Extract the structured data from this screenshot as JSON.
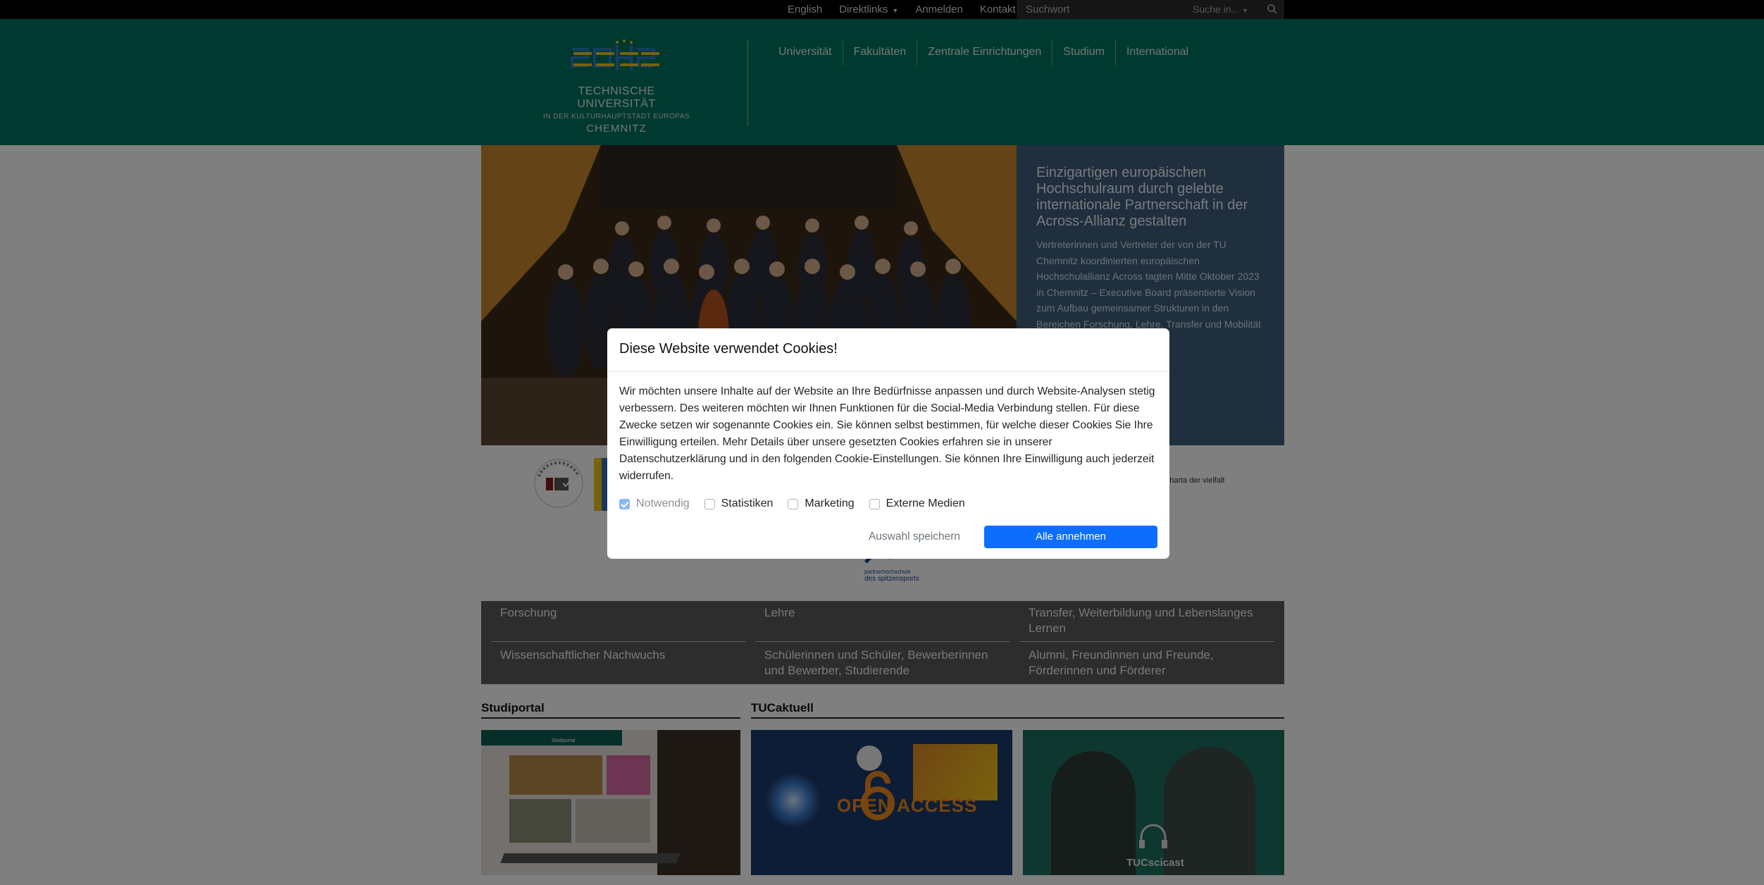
{
  "topbar": {
    "links": [
      "English",
      "Direktlinks",
      "Anmelden",
      "Kontakt"
    ],
    "search_placeholder": "Suchwort",
    "search_in": "Suche in..."
  },
  "header": {
    "logo_line1": "TECHNISCHE UNIVERSITÄT",
    "logo_line2": "IN DER KULTURHAUPTSTADT EUROPAS",
    "logo_line3": "CHEMNITZ",
    "nav": [
      "Universität",
      "Fakultäten",
      "Zentrale Einrichtungen",
      "Studium",
      "International"
    ]
  },
  "hero": {
    "headline": "Einzigartigen europäischen Hochschulraum durch gelebte internationale Partnerschaft in der Across-Allianz gestalten",
    "text": "Vertreterinnen und Vertreter der von der TU Chemnitz koordinierten europäischen Hochschulallianz Across tagten Mitte Oktober 2023 in Chemnitz – Executive Board präsentierte Vision zum Aufbau gemeinsamer Strukturen in den Bereichen Forschung, Lehre, Transfer und Mobilität"
  },
  "partners": {
    "charta": "charta der vielfalt",
    "spitzensport_1": "partnerhochschule",
    "spitzensport_2": "des spitzensports"
  },
  "linkgrid": [
    "Forschung",
    "Lehre",
    "Transfer, Weiterbildung und Lebenslanges Lernen",
    "Wissenschaftlicher Nachwuchs",
    "Schülerinnen und Schüler, Bewerberinnen und Bewerber, Studierende",
    "Alumni, Freundinnen und Freunde, Förderinnen und Förderer"
  ],
  "sections": {
    "studiportal": "Studiportal",
    "tucaktuell": "TUCaktuell",
    "open_access": "OPEN ACCESS",
    "tucscicast": "TUCscicast",
    "studiportal_thumb_title": "Studiportal"
  },
  "cookie": {
    "title": "Diese Website verwendet Cookies!",
    "body": "Wir möchten unsere Inhalte auf der Website an Ihre Bedürfnisse anpassen und durch Website-Analysen stetig verbessern. Des weiteren möchten wir Ihnen Funktionen für die Social-Media Verbindung stellen. Für diese Zwecke setzen wir sogenannte Cookies ein. Sie können selbst bestimmen, für welche dieser Cookies Sie Ihre Einwilligung erteilen. Mehr Details über unsere gesetzten Cookies erfahren sie in unserer Datenschutzerklärung und in den folgenden Cookie-Einstellungen. Sie können Ihre Einwilligung auch jederzeit widerrufen.",
    "options": [
      {
        "label": "Notwendig",
        "checked": true,
        "disabled": true
      },
      {
        "label": "Statistiken",
        "checked": false,
        "disabled": false
      },
      {
        "label": "Marketing",
        "checked": false,
        "disabled": false
      },
      {
        "label": "Externe Medien",
        "checked": false,
        "disabled": false
      }
    ],
    "save_label": "Auswahl speichern",
    "accept_all_label": "Alle annehmen"
  },
  "colors": {
    "header_green": "#00725e",
    "hero_panel": "#3f5e7c",
    "primary_button": "#0d6efd",
    "linkgrid_bg": "#5a5a5a"
  }
}
